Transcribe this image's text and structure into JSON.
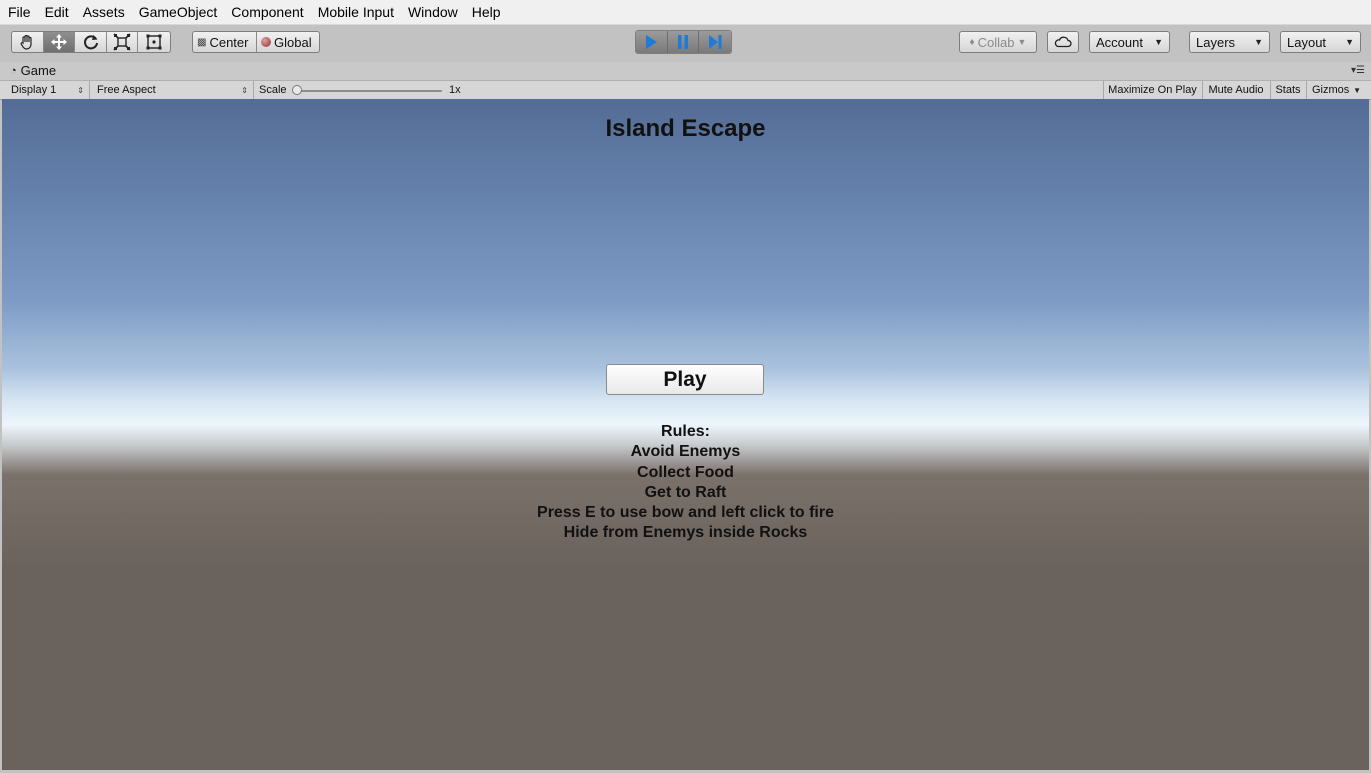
{
  "menubar": {
    "items": [
      "File",
      "Edit",
      "Assets",
      "GameObject",
      "Component",
      "Mobile Input",
      "Window",
      "Help"
    ]
  },
  "toolbar": {
    "tools": [
      "hand-tool-icon",
      "move-tool-icon",
      "rotate-tool-icon",
      "scale-tool-icon",
      "rect-tool-icon"
    ],
    "active_tool": "move-tool-icon",
    "pivot_label": "Center",
    "space_label": "Global",
    "play_controls": [
      "play-icon",
      "pause-icon",
      "step-icon"
    ],
    "collab_label": "Collab",
    "account_label": "Account",
    "layers_label": "Layers",
    "layout_label": "Layout"
  },
  "game_tab": {
    "title": "Game",
    "display_label": "Display 1",
    "aspect_label": "Free Aspect",
    "scale_label": "Scale",
    "scale_value": "1x",
    "maximize_label": "Maximize On Play",
    "mute_label": "Mute Audio",
    "stats_label": "Stats",
    "gizmos_label": "Gizmos"
  },
  "game": {
    "title": "Island Escape",
    "play_button": "Play",
    "rules": [
      "Rules:",
      "Avoid Enemys",
      "Collect Food",
      "Get to Raft",
      "Press E to use bow and left click to fire",
      "Hide from Enemys inside Rocks"
    ]
  },
  "colors": {
    "play_active": "#1f7bd6",
    "sky_top": "#546c95",
    "ground": "#6a625c"
  }
}
